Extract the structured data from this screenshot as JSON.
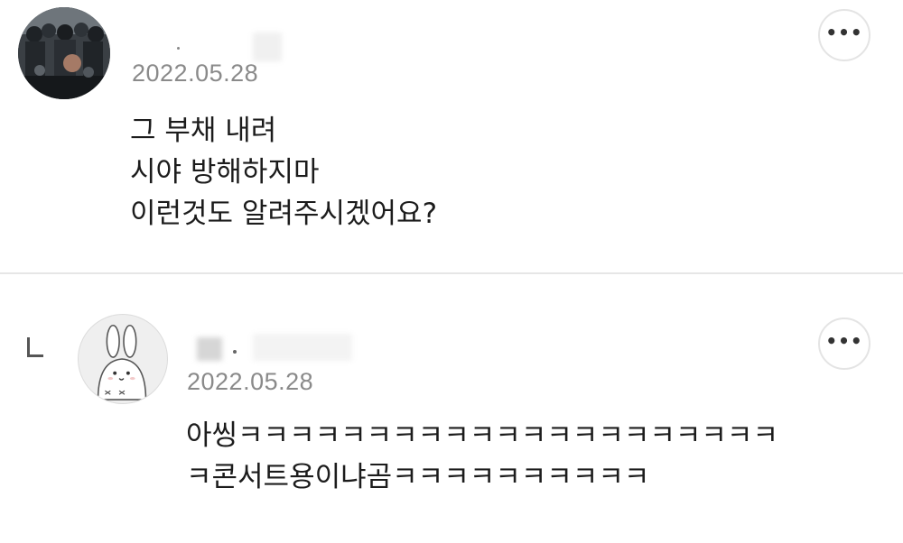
{
  "comments": [
    {
      "date": "2022.05.28",
      "lines": [
        "그 부채 내려",
        "시야 방해하지마",
        "이런것도 알려주시겠어요?"
      ],
      "more_icon": "more-horizontal-icon",
      "avatar": "crowd-photo"
    },
    {
      "is_reply": true,
      "reply_icon": "reply-arrow-icon",
      "date": "2022.05.28",
      "lines": [
        "아씽ㅋㅋㅋㅋㅋㅋㅋㅋㅋㅋㅋㅋㅋㅋㅋㅋㅋㅋㅋㅋㅋ",
        "ㅋ콘서트용이냐곰ㅋㅋㅋㅋㅋㅋㅋㅋㅋㅋ"
      ],
      "more_icon": "more-horizontal-icon",
      "avatar": "rabbit-illustration"
    }
  ],
  "more_label": "•••"
}
